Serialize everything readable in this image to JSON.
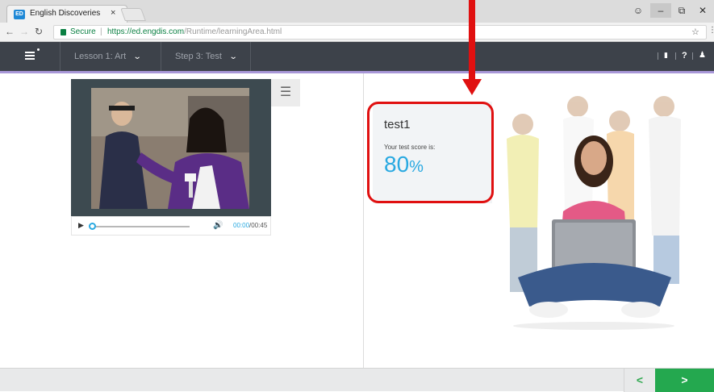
{
  "browser": {
    "tab_title": "English Discoveries",
    "tab_favicon_text": "ED",
    "tab_close": "×",
    "secure_label": "Secure",
    "url_host": "https://ed.engdis.com",
    "url_path": "/Runtime/learningArea.html",
    "icons": [
      "back-icon",
      "forward-icon",
      "reload-icon",
      "lock-icon",
      "star-icon",
      "account-icon",
      "minimize-icon",
      "maximize-icon",
      "close-icon"
    ]
  },
  "header": {
    "lesson_label": "Lesson 1: Art",
    "step_label": "Step 3: Test",
    "icons": [
      "menu-icon",
      "chat-icon",
      "help-icon",
      "user-icon"
    ],
    "help_glyph": "?",
    "accent_color": "#a897d8",
    "bar_color": "#3d424a"
  },
  "video": {
    "time_current": "00:00",
    "time_total": "/00:45",
    "progress_fraction": 0
  },
  "score": {
    "title": "test1",
    "label": "Your test score is:",
    "value": "80",
    "unit": "%",
    "value_color": "#29a9e1"
  },
  "annotation": {
    "color": "#e01010"
  },
  "footer": {
    "prev_glyph": "<",
    "next_glyph": ">",
    "next_color": "#24a84f"
  }
}
